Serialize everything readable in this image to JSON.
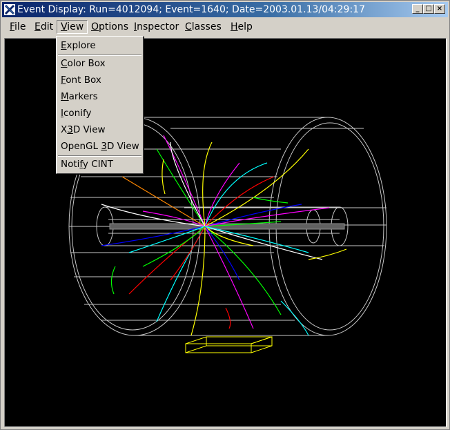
{
  "window": {
    "title": "Event Display: Run=4012094; Event=1640; Date=2003.01.13/04:29:17",
    "minimize": "_",
    "maximize": "□",
    "close": "×"
  },
  "menubar": {
    "items": [
      {
        "first": "F",
        "rest": "ile"
      },
      {
        "first": "E",
        "rest": "dit"
      },
      {
        "first": "V",
        "rest": "iew"
      },
      {
        "first": "O",
        "rest": "ptions"
      },
      {
        "first": "I",
        "rest": "nspector"
      },
      {
        "first": "C",
        "rest": "lasses"
      },
      {
        "first": "H",
        "rest": "elp"
      }
    ],
    "active_index": 2
  },
  "view_menu": {
    "items": [
      {
        "pre": "",
        "u": "E",
        "post": "xplore",
        "enabled": true
      },
      {
        "pre": "",
        "u": "C",
        "post": "olor Box",
        "enabled": true
      },
      {
        "pre": "",
        "u": "F",
        "post": "ont Box",
        "enabled": true
      },
      {
        "pre": "",
        "u": "M",
        "post": "arkers",
        "enabled": true
      },
      {
        "pre": "",
        "u": "I",
        "post": "conify",
        "enabled": true
      },
      {
        "pre": "X",
        "u": "3",
        "post": "D View",
        "enabled": true
      },
      {
        "pre": "OpenGL ",
        "u": "3",
        "post": "D View",
        "enabled": true
      },
      {
        "pre": "Noti",
        "u": "f",
        "post": "y CINT",
        "enabled": true
      }
    ]
  },
  "colors": {
    "title_gradient_start": "#0a246a",
    "title_gradient_end": "#a6caf0",
    "detector_wire": "#c8c8c8",
    "calorimeter_box": "#ffff00",
    "canvas_bg": "#000000"
  }
}
